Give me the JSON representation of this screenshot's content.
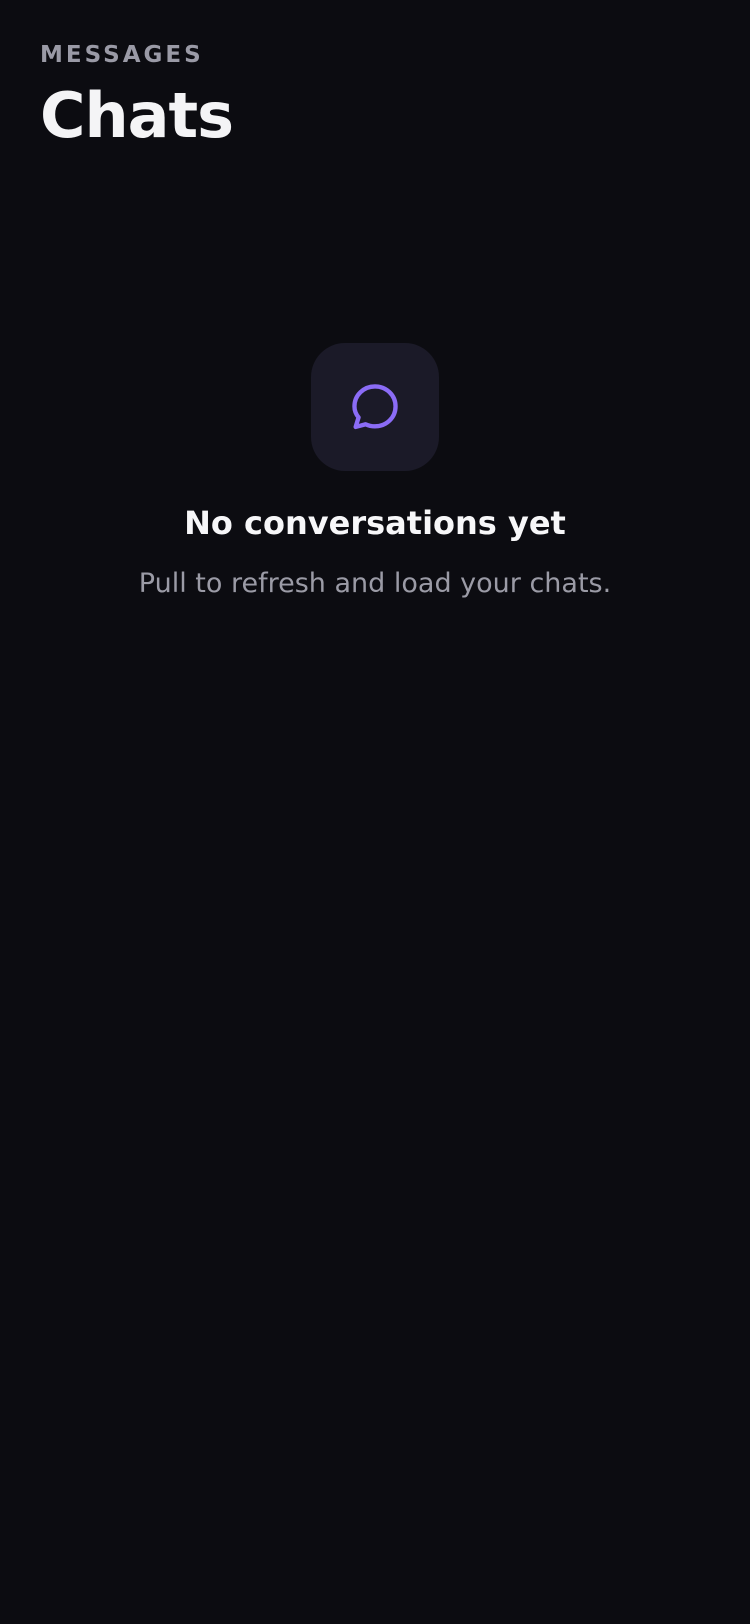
{
  "header": {
    "eyebrow": "MESSAGES",
    "title": "Chats"
  },
  "empty_state": {
    "icon": "chat-bubble-icon",
    "title": "No conversations yet",
    "subtitle": "Pull to refresh and load your chats."
  },
  "colors": {
    "background": "#0c0c11",
    "icon_tile": "#1b1a28",
    "accent": "#8b6cf6",
    "muted_text": "#9a9aa6"
  }
}
